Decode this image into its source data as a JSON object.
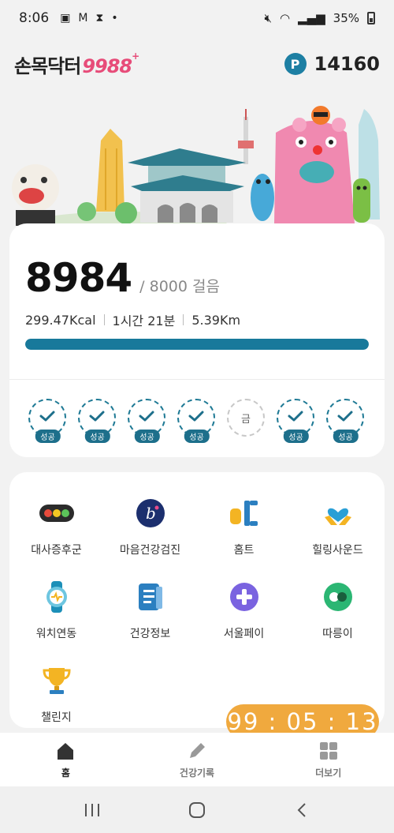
{
  "status": {
    "time": "8:06",
    "battery": "35%"
  },
  "header": {
    "logo_text": "손목닥터",
    "logo_num": "9988",
    "logo_plus": "+",
    "points_icon": "P",
    "points": "14160"
  },
  "steps": {
    "count": "8984",
    "goal_text": "/ 8000 걸음",
    "kcal": "299.47Kcal",
    "duration": "1시간 21분",
    "distance": "5.39Km",
    "progress": 1.0
  },
  "week": [
    {
      "state": "success",
      "label": "성공"
    },
    {
      "state": "success",
      "label": "성공"
    },
    {
      "state": "success",
      "label": "성공"
    },
    {
      "state": "success",
      "label": "성공"
    },
    {
      "state": "pending",
      "label": "금"
    },
    {
      "state": "success",
      "label": "성공"
    },
    {
      "state": "success",
      "label": "성공"
    }
  ],
  "menu": [
    {
      "label": "대사증후군",
      "icon": "traffic-light-icon"
    },
    {
      "label": "마음건강검진",
      "icon": "mind-b-icon"
    },
    {
      "label": "홈트",
      "icon": "dumbbell-icon"
    },
    {
      "label": "힐링사운드",
      "icon": "heart-hands-icon"
    },
    {
      "label": "워치연동",
      "icon": "watch-icon"
    },
    {
      "label": "건강정보",
      "icon": "document-icon"
    },
    {
      "label": "서울페이",
      "icon": "plus-circle-icon"
    },
    {
      "label": "따릉이",
      "icon": "bike-icon"
    },
    {
      "label": "챌린지",
      "icon": "trophy-icon"
    }
  ],
  "timer": "99 : 05 : 13",
  "bottom_nav": [
    {
      "label": "홈"
    },
    {
      "label": "건강기록"
    },
    {
      "label": "더보기"
    }
  ],
  "colors": {
    "accent": "#1d7fa3",
    "timer": "#f0a93e",
    "logo_num": "#e74c79"
  }
}
